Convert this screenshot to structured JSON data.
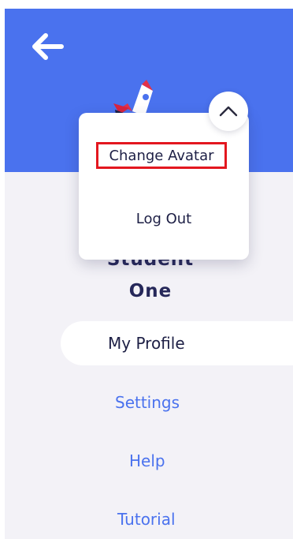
{
  "colors": {
    "header_blue": "#4a72ee",
    "background": "#f3f2f7",
    "dark_text": "#1d1f45",
    "link_text": "#4a72ee",
    "highlight_red": "#e3171f"
  },
  "header": {
    "back_icon": "arrow-left-icon"
  },
  "profile": {
    "avatar_icon": "rocket-avatar-icon",
    "username": "Student One"
  },
  "dropdown": {
    "toggle_icon": "chevron-up-icon",
    "items": [
      {
        "label": "Change Avatar",
        "highlighted": true
      },
      {
        "label": "Log Out",
        "highlighted": false
      }
    ]
  },
  "nav": {
    "items": [
      {
        "label": "My Profile",
        "active": true
      },
      {
        "label": "Settings",
        "active": false
      },
      {
        "label": "Help",
        "active": false
      },
      {
        "label": "Tutorial",
        "active": false
      }
    ]
  }
}
